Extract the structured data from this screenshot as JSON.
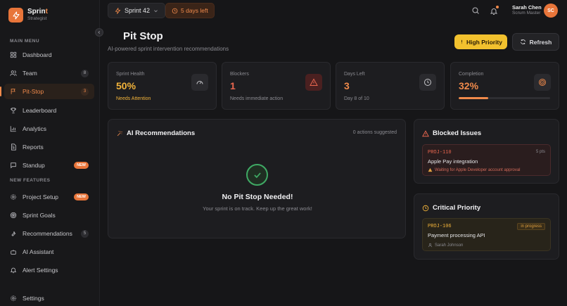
{
  "brand": {
    "name_start": "Sprin",
    "name_accent": "t",
    "subtitle": "Strategist"
  },
  "sidebar": {
    "main_menu_label": "MAIN MENU",
    "new_features_label": "NEW FEATURES",
    "items": [
      {
        "label": "Dashboard",
        "icon": "grid-icon"
      },
      {
        "label": "Team",
        "icon": "users-icon",
        "count": "8"
      },
      {
        "label": "Pit-Stop",
        "icon": "flag-icon",
        "count": "3",
        "active": true
      },
      {
        "label": "Leaderboard",
        "icon": "trophy-icon"
      },
      {
        "label": "Analytics",
        "icon": "bar-chart-icon"
      },
      {
        "label": "Reports",
        "icon": "document-icon"
      },
      {
        "label": "Standup",
        "icon": "message-icon",
        "badge": "NEW"
      }
    ],
    "feature_items": [
      {
        "label": "Project Setup",
        "icon": "gear-icon",
        "badge": "NEW"
      },
      {
        "label": "Sprint Goals",
        "icon": "target-icon"
      },
      {
        "label": "Recommendations",
        "icon": "wrench-icon",
        "count": "5"
      },
      {
        "label": "AI Assistant",
        "icon": "bot-icon"
      },
      {
        "label": "Alert Settings",
        "icon": "bell-icon"
      }
    ],
    "settings_label": "Settings"
  },
  "header": {
    "sprint": "Sprint 42",
    "days_left": "5 days left",
    "user_name": "Sarah Chen",
    "user_role": "Scrum Master",
    "avatar_initials": "SC"
  },
  "page": {
    "title": "Pit Stop",
    "subtitle": "AI-powered sprint intervention recommendations",
    "priority_button": "High Priority",
    "refresh_button": "Refresh"
  },
  "stats": [
    {
      "label": "Sprint Health",
      "value": "50%",
      "sub": "Needs Attention",
      "value_color": "#f2b33a",
      "sub_color": "#f2b33a"
    },
    {
      "label": "Blockers",
      "value": "1",
      "sub": "Needs immediate action",
      "value_color": "#e8664f",
      "sub_color": "#8a8a90"
    },
    {
      "label": "Days Left",
      "value": "3",
      "sub": "Day 8 of 10",
      "value_color": "#f08a4b",
      "sub_color": "#8a8a90"
    },
    {
      "label": "Completion",
      "value": "32%",
      "progress": 0.32,
      "value_color": "#f08a4b"
    }
  ],
  "ai": {
    "title": "AI Recommendations",
    "count_text": "0 actions suggested",
    "empty_title": "No Pit Stop Needed!",
    "empty_sub": "Your sprint is on track. Keep up the great work!"
  },
  "blocked": {
    "title": "Blocked Issues",
    "issue_key": "PROJ-110",
    "points": "5 pts",
    "name": "Apple Pay integration",
    "note": "Waiting for Apple Developer account approval"
  },
  "critical": {
    "title": "Critical Priority",
    "issue_key": "PROJ-106",
    "status": "in progress",
    "name": "Payment processing API",
    "assignee": "Sarah Johnson"
  },
  "colors": {
    "accent": "#f08a4b",
    "warning": "#f2c12e",
    "danger": "#e8664f",
    "success": "#3fa964"
  }
}
